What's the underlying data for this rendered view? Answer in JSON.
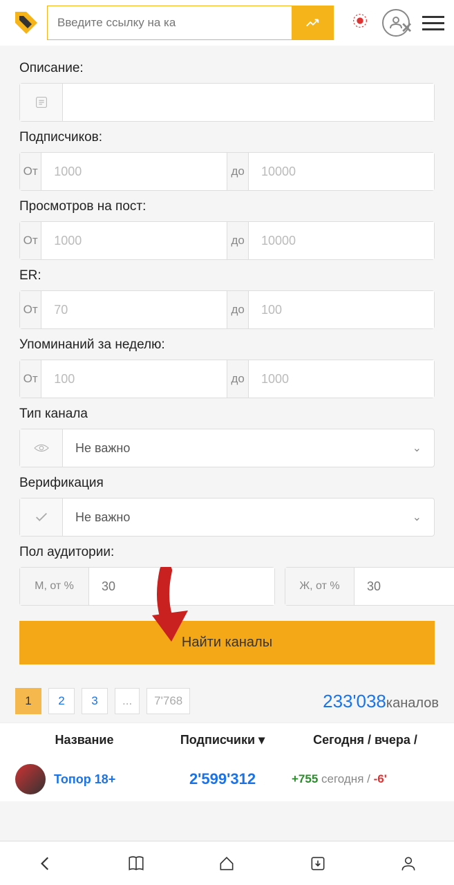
{
  "header": {
    "search_placeholder": "Введите ссылку на ка"
  },
  "form": {
    "description": {
      "label": "Описание:",
      "value": ""
    },
    "subscribers": {
      "label": "Подписчиков:",
      "from": "От",
      "from_ph": "1000",
      "to": "до",
      "to_ph": "10000"
    },
    "views": {
      "label": "Просмотров на пост:",
      "from": "От",
      "from_ph": "1000",
      "to": "до",
      "to_ph": "10000"
    },
    "er": {
      "label": "ER:",
      "from": "От",
      "from_ph": "70",
      "to": "до",
      "to_ph": "100"
    },
    "mentions": {
      "label": "Упоминаний за неделю:",
      "from": "От",
      "from_ph": "100",
      "to": "до",
      "to_ph": "1000"
    },
    "channel_type": {
      "label": "Тип канала",
      "value": "Не важно"
    },
    "verification": {
      "label": "Верификация",
      "value": "Не важно"
    },
    "gender": {
      "label": "Пол аудитории:",
      "m_label": "М, от %",
      "m_ph": "30",
      "f_label": "Ж, от %",
      "f_ph": "30"
    },
    "find_button": "Найти каналы"
  },
  "pagination": {
    "pages": [
      "1",
      "2",
      "3",
      "...",
      "7'768"
    ],
    "total_num": "233'038",
    "total_label": "каналов"
  },
  "table": {
    "headers": {
      "name": "Название",
      "subs": "Подписчики",
      "today": "Сегодня / вчера /"
    },
    "rows": [
      {
        "name": "Топор 18+",
        "subs": "2'599'312",
        "today_pos": "+755",
        "today_lbl": " сегодня / ",
        "today_neg": "-6'"
      }
    ]
  }
}
